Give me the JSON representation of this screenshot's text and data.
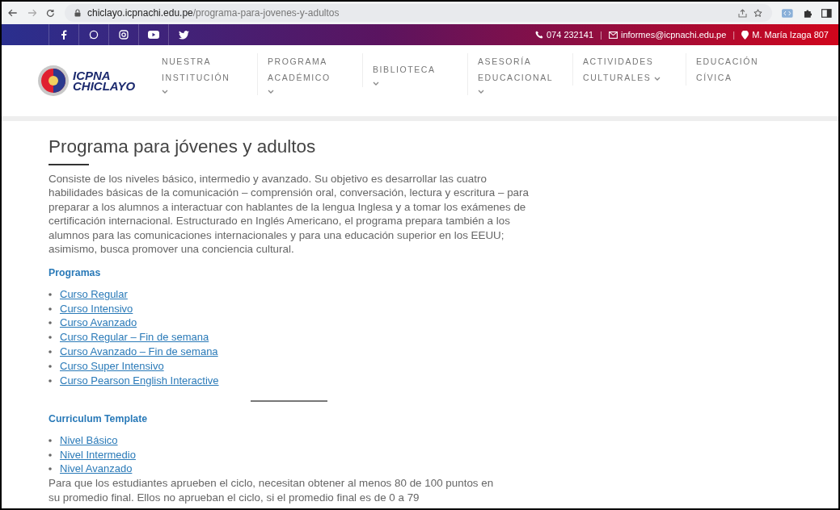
{
  "browser": {
    "url_host": "chiclayo.icpnachi.edu.pe",
    "url_path": "/programa-para-jovenes-y-adultos"
  },
  "top_bar": {
    "social": [
      {
        "kind": "facebook"
      },
      {
        "kind": "whatsapp"
      },
      {
        "kind": "instagram"
      },
      {
        "kind": "youtube"
      },
      {
        "kind": "twitter"
      }
    ],
    "phone": "074 232141",
    "email": "informes@icpnachi.edu.pe",
    "address": "M. María Izaga 807",
    "separator": "|"
  },
  "header": {
    "logo": {
      "line1": "ICPNA",
      "line2": "CHICLAYO"
    },
    "nav": [
      {
        "lines": [
          "NUESTRA",
          "INSTITUCIÓN"
        ],
        "dropdown": true
      },
      {
        "lines": [
          "PROGRAMA",
          "ACADÉMICO"
        ],
        "dropdown": true
      },
      {
        "lines": [
          "BIBLIOTECA"
        ],
        "dropdown": true
      },
      {
        "lines": [
          "ASESORÍA",
          "EDUCACIONAL"
        ],
        "dropdown": true
      },
      {
        "lines": [
          "ACTIVIDADES",
          "CULTURALES"
        ],
        "dropdown": true
      },
      {
        "lines": [
          "EDUCACIÓN",
          "CÍVICA"
        ],
        "dropdown": false
      }
    ]
  },
  "content": {
    "title": "Programa para jóvenes y adultos",
    "intro": "Consiste de los niveles básico, intermedio y avanzado. Su objetivo es desarrollar las cuatro habilidades básicas de la comunicación – comprensión oral, conversación, lectura y escritura – para preparar a los alumnos a interactuar con hablantes de la lengua Inglesa y a tomar los exámenes de certificación internacional. Estructurado en Inglés Americano, el programa prepara también a los alumnos para las comunicaciones internacionales y para una educación superior en los EEUU; asimismo, busca promover una conciencia cultural.",
    "sections": [
      {
        "heading": "Programas",
        "links": [
          "Curso Regular",
          "Curso Intensivo",
          "Curso Avanzado",
          "Curso Regular – Fin de semana",
          "Curso Avanzado – Fin de semana",
          "Curso Super Intensivo",
          "Curso Pearson English Interactive"
        ]
      },
      {
        "heading": "Curriculum Template",
        "links": [
          "Nivel Básico",
          "Nivel Intermedio",
          "Nivel Avanzado"
        ]
      }
    ],
    "footer_text": "Para que los estudiantes aprueben el ciclo, necesitan obtener al menos 80 de 100 puntos en su promedio final. Ellos no aprueban el ciclo, si el promedio final es de 0 a 79"
  }
}
